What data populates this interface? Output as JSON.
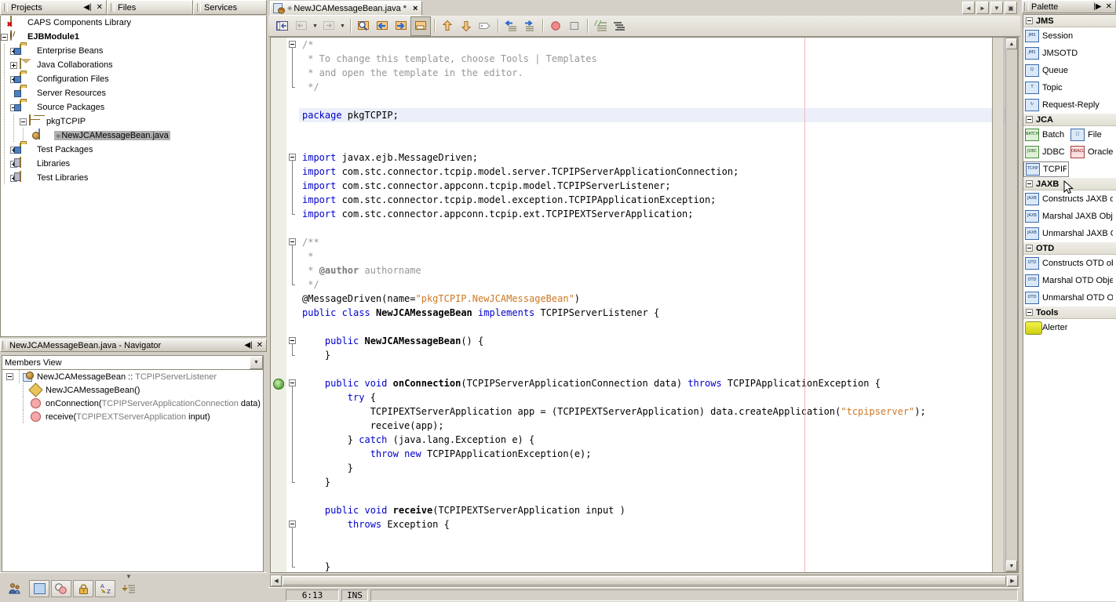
{
  "window_tabs": [
    {
      "label": "Projects",
      "id": "projects"
    },
    {
      "label": "Files",
      "id": "files"
    },
    {
      "label": "Services",
      "id": "services"
    }
  ],
  "project_tree": [
    {
      "label": "CAPS Components Library",
      "icon": "caps-library-icon",
      "depth": 0,
      "expander": "none",
      "bold": false,
      "selected": false
    },
    {
      "label": "EJBModule1",
      "icon": "ejb-module-icon",
      "depth": 0,
      "expander": "minus",
      "bold": true,
      "selected": false
    },
    {
      "label": "Enterprise Beans",
      "icon": "folder-beans-icon",
      "depth": 1,
      "expander": "plus",
      "bold": false,
      "selected": false
    },
    {
      "label": "Java Collaborations",
      "icon": "java-collaborations-icon",
      "depth": 1,
      "expander": "plus",
      "bold": false,
      "selected": false
    },
    {
      "label": "Configuration Files",
      "icon": "folder-config-icon",
      "depth": 1,
      "expander": "plus",
      "bold": false,
      "selected": false
    },
    {
      "label": "Server Resources",
      "icon": "folder-server-icon",
      "depth": 1,
      "expander": "none",
      "bold": false,
      "selected": false
    },
    {
      "label": "Source Packages",
      "icon": "folder-source-icon",
      "depth": 1,
      "expander": "minus",
      "bold": false,
      "selected": false
    },
    {
      "label": "pkgTCPIP",
      "icon": "package-icon",
      "depth": 2,
      "expander": "minus",
      "bold": false,
      "selected": false
    },
    {
      "label": "NewJCAMessageBean.java",
      "icon": "java-bean-file-icon",
      "depth": 3,
      "expander": "none",
      "bold": false,
      "selected": true
    },
    {
      "label": "Test Packages",
      "icon": "folder-test-icon",
      "depth": 1,
      "expander": "plus",
      "bold": false,
      "selected": false
    },
    {
      "label": "Libraries",
      "icon": "libraries-icon",
      "depth": 1,
      "expander": "plus",
      "bold": false,
      "selected": false
    },
    {
      "label": "Test Libraries",
      "icon": "test-libraries-icon",
      "depth": 1,
      "expander": "plus",
      "bold": false,
      "selected": false
    }
  ],
  "navigator": {
    "title": "NewJCAMessageBean.java - Navigator",
    "view_selected": "Members View",
    "members": [
      {
        "name": "NewJCAMessageBean :: ",
        "type": "TCPIPServerListener",
        "kind": "class",
        "depth": 0
      },
      {
        "name": "NewJCAMessageBean()",
        "type": "",
        "kind": "constructor",
        "depth": 1
      },
      {
        "name": "onConnection(",
        "type": "TCPIPServerApplicationConnection",
        "tail": " data)",
        "kind": "method",
        "depth": 1
      },
      {
        "name": "receive(",
        "type": "TCPIPEXTServerApplication",
        "tail": " input)",
        "kind": "method",
        "depth": 1
      }
    ]
  },
  "bottom_toolbar": {
    "buttons": [
      {
        "name": "team-icon"
      },
      {
        "name": "filter-blank-icon"
      },
      {
        "name": "filter-shapes-icon"
      },
      {
        "name": "lock-icon"
      },
      {
        "name": "sort-alpha-icon"
      },
      {
        "name": "expand-all-icon"
      }
    ]
  },
  "editor": {
    "tab": {
      "label": "NewJCAMessageBean.java",
      "modified_marker": "*",
      "close": "×"
    },
    "nav_buttons": [
      {
        "name": "scroll-tabs-left-button",
        "glyph": "◄"
      },
      {
        "name": "scroll-tabs-right-button",
        "glyph": "►"
      },
      {
        "name": "tab-list-button",
        "glyph": "▼"
      },
      {
        "name": "maximize-button",
        "glyph": "▣"
      }
    ],
    "toolbar": [
      {
        "name": "toggle-bookmark-button"
      },
      {
        "name": "previous-bookmark-button",
        "dropdown": true
      },
      {
        "name": "next-bookmark-button",
        "dropdown": true
      },
      {
        "name": "find-selection-button"
      },
      {
        "name": "find-previous-button"
      },
      {
        "name": "find-next-button"
      },
      {
        "name": "toggle-highlight-search-button",
        "pressed": true
      },
      {
        "name": "previous-error-button"
      },
      {
        "name": "next-error-button"
      },
      {
        "name": "shift-line-left-button"
      },
      {
        "name": "shift-line-right-button"
      },
      {
        "name": "start-macro-recording-button"
      },
      {
        "name": "stop-macro-recording-button"
      },
      {
        "name": "comment-button"
      },
      {
        "name": "uncomment-button"
      }
    ],
    "status": {
      "caret": "6:13",
      "insert_mode": "INS"
    },
    "code_lines": [
      {
        "fold": "start",
        "segments": [
          {
            "t": "/*",
            "c": "cm"
          }
        ]
      },
      {
        "segments": [
          {
            "t": " * To change this template, choose Tools | Templates",
            "c": "cm"
          }
        ]
      },
      {
        "segments": [
          {
            "t": " * and open the template in the editor.",
            "c": "cm"
          }
        ]
      },
      {
        "fold": "end",
        "segments": [
          {
            "t": " */",
            "c": "cm"
          }
        ]
      },
      {
        "segments": []
      },
      {
        "highlight": true,
        "segments": [
          {
            "t": "package",
            "c": "kw"
          },
          {
            "t": " pkgTCPIP;",
            "c": ""
          }
        ]
      },
      {
        "segments": []
      },
      {
        "segments": []
      },
      {
        "fold": "start",
        "segments": [
          {
            "t": "import",
            "c": "kw"
          },
          {
            "t": " javax.ejb.MessageDriven;",
            "c": ""
          }
        ]
      },
      {
        "segments": [
          {
            "t": "import",
            "c": "kw"
          },
          {
            "t": " com.stc.connector.tcpip.model.server.TCPIPServerApplicationConnection;",
            "c": ""
          }
        ]
      },
      {
        "segments": [
          {
            "t": "import",
            "c": "kw"
          },
          {
            "t": " com.stc.connector.appconn.tcpip.model.TCPIPServerListener;",
            "c": ""
          }
        ]
      },
      {
        "segments": [
          {
            "t": "import",
            "c": "kw"
          },
          {
            "t": " com.stc.connector.tcpip.model.exception.TCPIPApplicationException;",
            "c": ""
          }
        ]
      },
      {
        "fold": "end",
        "segments": [
          {
            "t": "import",
            "c": "kw"
          },
          {
            "t": " com.stc.connector.appconn.tcpip.ext.TCPIPEXTServerApplication;",
            "c": ""
          }
        ]
      },
      {
        "segments": []
      },
      {
        "fold": "start",
        "segments": [
          {
            "t": "/**",
            "c": "cm"
          }
        ]
      },
      {
        "segments": [
          {
            "t": " *",
            "c": "cm"
          }
        ]
      },
      {
        "segments": [
          {
            "t": " * ",
            "c": "cm"
          },
          {
            "t": "@author",
            "c": "cmb"
          },
          {
            "t": " authorname",
            "c": "cm"
          }
        ]
      },
      {
        "fold": "end",
        "segments": [
          {
            "t": " */",
            "c": "cm"
          }
        ]
      },
      {
        "segments": [
          {
            "t": "@MessageDriven(name=",
            "c": ""
          },
          {
            "t": "\"pkgTCPIP.NewJCAMessageBean\"",
            "c": "st"
          },
          {
            "t": ")",
            "c": ""
          }
        ]
      },
      {
        "segments": [
          {
            "t": "public",
            "c": "kw"
          },
          {
            "t": " ",
            "c": ""
          },
          {
            "t": "class",
            "c": "kw"
          },
          {
            "t": " ",
            "c": ""
          },
          {
            "t": "NewJCAMessageBean",
            "c": "bd"
          },
          {
            "t": " ",
            "c": ""
          },
          {
            "t": "implements",
            "c": "kw"
          },
          {
            "t": " TCPIPServerListener {",
            "c": ""
          }
        ]
      },
      {
        "segments": []
      },
      {
        "fold": "start",
        "segments": [
          {
            "t": "    ",
            "c": ""
          },
          {
            "t": "public",
            "c": "kw"
          },
          {
            "t": " ",
            "c": ""
          },
          {
            "t": "NewJCAMessageBean",
            "c": "bd"
          },
          {
            "t": "() {",
            "c": ""
          }
        ]
      },
      {
        "fold": "end",
        "segments": [
          {
            "t": "    }",
            "c": ""
          }
        ]
      },
      {
        "segments": []
      },
      {
        "hint": true,
        "fold": "start",
        "segments": [
          {
            "t": "    ",
            "c": ""
          },
          {
            "t": "public",
            "c": "kw"
          },
          {
            "t": " ",
            "c": ""
          },
          {
            "t": "void",
            "c": "kw"
          },
          {
            "t": " ",
            "c": ""
          },
          {
            "t": "onConnection",
            "c": "bd"
          },
          {
            "t": "(TCPIPServerApplicationConnection data) ",
            "c": ""
          },
          {
            "t": "throws",
            "c": "kw"
          },
          {
            "t": " TCPIPApplicationException {",
            "c": ""
          }
        ]
      },
      {
        "segments": [
          {
            "t": "        ",
            "c": ""
          },
          {
            "t": "try",
            "c": "kw"
          },
          {
            "t": " {",
            "c": ""
          }
        ]
      },
      {
        "segments": [
          {
            "t": "            TCPIPEXTServerApplication app = (TCPIPEXTServerApplication) data.createApplication(",
            "c": ""
          },
          {
            "t": "\"tcpipserver\"",
            "c": "st"
          },
          {
            "t": ");",
            "c": ""
          }
        ]
      },
      {
        "segments": [
          {
            "t": "            receive(app);",
            "c": ""
          }
        ]
      },
      {
        "segments": [
          {
            "t": "        } ",
            "c": ""
          },
          {
            "t": "catch",
            "c": "kw"
          },
          {
            "t": " (java.lang.Exception e) {",
            "c": ""
          }
        ]
      },
      {
        "segments": [
          {
            "t": "            ",
            "c": ""
          },
          {
            "t": "throw",
            "c": "kw"
          },
          {
            "t": " ",
            "c": ""
          },
          {
            "t": "new",
            "c": "kw"
          },
          {
            "t": " TCPIPApplicationException(e);",
            "c": ""
          }
        ]
      },
      {
        "segments": [
          {
            "t": "        }",
            "c": ""
          }
        ]
      },
      {
        "fold": "end",
        "segments": [
          {
            "t": "    }",
            "c": ""
          }
        ]
      },
      {
        "segments": []
      },
      {
        "segments": [
          {
            "t": "    ",
            "c": ""
          },
          {
            "t": "public",
            "c": "kw"
          },
          {
            "t": " ",
            "c": ""
          },
          {
            "t": "void",
            "c": "kw"
          },
          {
            "t": " ",
            "c": ""
          },
          {
            "t": "receive",
            "c": "bd"
          },
          {
            "t": "(TCPIPEXTServerApplication input )",
            "c": ""
          }
        ]
      },
      {
        "fold": "start",
        "segments": [
          {
            "t": "        ",
            "c": ""
          },
          {
            "t": "throws",
            "c": "kw"
          },
          {
            "t": " Exception {",
            "c": ""
          }
        ]
      },
      {
        "segments": []
      },
      {
        "segments": []
      },
      {
        "fold": "end",
        "segments": [
          {
            "t": "    }",
            "c": ""
          }
        ]
      },
      {
        "segments": [
          {
            "t": "}",
            "c": ""
          }
        ]
      }
    ]
  },
  "palette": {
    "title": "Palette",
    "categories": [
      {
        "name": "JMS",
        "layout": "single",
        "items": [
          {
            "label": "Session",
            "icon": "jms-session-icon",
            "badge": "JMS"
          },
          {
            "label": "JMSOTD",
            "icon": "jms-otd-icon",
            "badge": "JMS"
          },
          {
            "label": "Queue",
            "icon": "jms-queue-icon",
            "badge": "Q"
          },
          {
            "label": "Topic",
            "icon": "jms-topic-icon",
            "badge": "T"
          },
          {
            "label": "Request-Reply",
            "icon": "request-reply-icon",
            "badge": "↻"
          }
        ]
      },
      {
        "name": "JCA",
        "layout": "double",
        "items": [
          {
            "label": "Batch",
            "icon": "jca-batch-icon",
            "badge": "BATCH"
          },
          {
            "label": "File",
            "icon": "jca-file-icon",
            "badge": "□"
          },
          {
            "label": "JDBC",
            "icon": "jca-jdbc-icon",
            "badge": "JDBC"
          },
          {
            "label": "Oracle",
            "icon": "jca-oracle-icon",
            "badge": "ORACLE"
          },
          {
            "label": "TCPIP",
            "icon": "jca-tcpip-icon",
            "badge": "TCPIP",
            "selected": true
          }
        ]
      },
      {
        "name": "JAXB",
        "layout": "single",
        "items": [
          {
            "label": "Constructs JAXB ob",
            "icon": "jaxb-construct-icon",
            "badge": "JAXB"
          },
          {
            "label": "Marshal JAXB Objec",
            "icon": "jaxb-marshal-icon",
            "badge": "JAXB"
          },
          {
            "label": "Unmarshal JAXB Ob",
            "icon": "jaxb-unmarshal-icon",
            "badge": "JAXB"
          }
        ]
      },
      {
        "name": "OTD",
        "layout": "single",
        "items": [
          {
            "label": "Constructs OTD obj",
            "icon": "otd-construct-icon",
            "badge": "OTD"
          },
          {
            "label": "Marshal OTD Object",
            "icon": "otd-marshal-icon",
            "badge": "OTD"
          },
          {
            "label": "Unmarshal OTD Obj",
            "icon": "otd-unmarshal-icon",
            "badge": "OTD"
          }
        ]
      },
      {
        "name": "Tools",
        "layout": "single",
        "items": [
          {
            "label": "Alerter",
            "icon": "alerter-icon",
            "badge": ""
          }
        ]
      }
    ]
  },
  "colors": {
    "chrome": "#d4d0c8",
    "keyword": "#0000cc",
    "comment": "#969696",
    "string": "#cc7722",
    "selection": "#b0b0b0",
    "current_line": "#eaeff9",
    "ok_green": "#4caf50"
  }
}
